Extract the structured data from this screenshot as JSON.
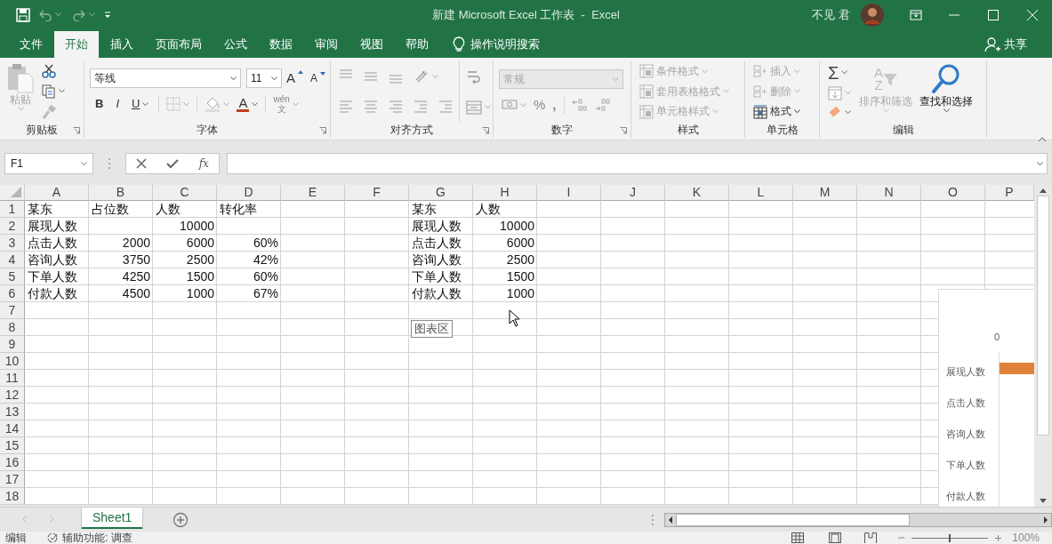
{
  "title_bar": {
    "title": "新建 Microsoft Excel 工作表  -  Excel",
    "user": "不见 君"
  },
  "ribbon_tabs": [
    {
      "label": "文件",
      "selected": false
    },
    {
      "label": "开始",
      "selected": true
    },
    {
      "label": "插入",
      "selected": false
    },
    {
      "label": "页面布局",
      "selected": false
    },
    {
      "label": "公式",
      "selected": false
    },
    {
      "label": "数据",
      "selected": false
    },
    {
      "label": "审阅",
      "selected": false
    },
    {
      "label": "视图",
      "selected": false
    },
    {
      "label": "帮助",
      "selected": false
    }
  ],
  "tell_me": "操作说明搜索",
  "share": "共享",
  "clipboard": {
    "paste": {
      "label": "粘贴",
      "disabled": true
    },
    "label": "剪贴板"
  },
  "font": {
    "name": "等线",
    "size": "11",
    "grow": "A",
    "shrink": "A",
    "styles": [
      "B",
      "I",
      "U"
    ],
    "color_letter": "A",
    "phonetic": [
      "wén",
      "文"
    ],
    "label": "字体"
  },
  "alignment": {
    "label": "对齐方式"
  },
  "number": {
    "format": {
      "value": "常规",
      "disabled": true
    },
    "percent": "%",
    "comma": ",",
    "label": "数字"
  },
  "styles": {
    "items": [
      {
        "label": "条件格式",
        "disabled": true
      },
      {
        "label": "套用表格格式",
        "disabled": true
      },
      {
        "label": "单元格样式",
        "disabled": true
      }
    ],
    "label": "样式"
  },
  "cells": {
    "items": [
      {
        "label": "插入",
        "disabled": true
      },
      {
        "label": "删除",
        "disabled": true
      },
      {
        "label": "格式",
        "disabled": false
      }
    ],
    "label": "单元格"
  },
  "editing": {
    "sum": "Σ",
    "sort": {
      "letters": [
        "A",
        "Z"
      ],
      "label": "排序和筛选",
      "disabled": true
    },
    "find": {
      "label": "查找和选择",
      "disabled": false
    },
    "label": "编辑"
  },
  "formula_bar": {
    "name_box": "F1",
    "fx": "fx"
  },
  "grid": {
    "columns": [
      "A",
      "B",
      "C",
      "D",
      "E",
      "F",
      "G",
      "H",
      "I",
      "J",
      "K",
      "L",
      "M",
      "N",
      "O",
      "P"
    ],
    "rows": [
      {
        "header": "1",
        "cells": [
          {
            "kind": "text",
            "text": "某东"
          },
          {
            "kind": "text",
            "text": "占位数"
          },
          {
            "kind": "text",
            "text": "人数"
          },
          {
            "kind": "text",
            "text": "转化率"
          },
          {
            "kind": "empty"
          },
          {
            "kind": "empty"
          },
          {
            "kind": "text",
            "text": "某东"
          },
          {
            "kind": "text",
            "text": "人数"
          }
        ]
      },
      {
        "header": "2",
        "cells": [
          {
            "kind": "text",
            "text": "展现人数"
          },
          {
            "kind": "empty"
          },
          {
            "kind": "number",
            "text": "10000"
          },
          {
            "kind": "empty"
          },
          {
            "kind": "empty"
          },
          {
            "kind": "empty"
          },
          {
            "kind": "text",
            "text": "展现人数"
          },
          {
            "kind": "number",
            "text": "10000"
          }
        ]
      },
      {
        "header": "3",
        "cells": [
          {
            "kind": "text",
            "text": "点击人数"
          },
          {
            "kind": "number",
            "text": "2000"
          },
          {
            "kind": "number",
            "text": "6000"
          },
          {
            "kind": "number",
            "text": "60%"
          },
          {
            "kind": "empty"
          },
          {
            "kind": "empty"
          },
          {
            "kind": "text",
            "text": "点击人数"
          },
          {
            "kind": "number",
            "text": "6000"
          }
        ]
      },
      {
        "header": "4",
        "cells": [
          {
            "kind": "text",
            "text": "咨询人数"
          },
          {
            "kind": "number",
            "text": "3750"
          },
          {
            "kind": "number",
            "text": "2500"
          },
          {
            "kind": "number",
            "text": "42%"
          },
          {
            "kind": "empty"
          },
          {
            "kind": "empty"
          },
          {
            "kind": "text",
            "text": "咨询人数"
          },
          {
            "kind": "number",
            "text": "2500"
          }
        ]
      },
      {
        "header": "5",
        "cells": [
          {
            "kind": "text",
            "text": "下单人数"
          },
          {
            "kind": "number",
            "text": "4250"
          },
          {
            "kind": "number",
            "text": "1500"
          },
          {
            "kind": "number",
            "text": "60%"
          },
          {
            "kind": "empty"
          },
          {
            "kind": "empty"
          },
          {
            "kind": "text",
            "text": "下单人数"
          },
          {
            "kind": "number",
            "text": "1500"
          }
        ]
      },
      {
        "header": "6",
        "cells": [
          {
            "kind": "text",
            "text": "付款人数"
          },
          {
            "kind": "number",
            "text": "4500"
          },
          {
            "kind": "number",
            "text": "1000"
          },
          {
            "kind": "number",
            "text": "67%"
          },
          {
            "kind": "empty"
          },
          {
            "kind": "empty"
          },
          {
            "kind": "text",
            "text": "付款人数"
          },
          {
            "kind": "number",
            "text": "1000"
          }
        ]
      },
      {
        "header": "7"
      },
      {
        "header": "8"
      },
      {
        "header": "9"
      },
      {
        "header": "10"
      },
      {
        "header": "11"
      },
      {
        "header": "12"
      },
      {
        "header": "13"
      },
      {
        "header": "14"
      },
      {
        "header": "15"
      },
      {
        "header": "16"
      },
      {
        "header": "17"
      },
      {
        "header": "18"
      }
    ]
  },
  "tooltip": "图表区",
  "chart": {
    "axis_label": "0",
    "categories": [
      {
        "label": "展现人数",
        "bar": true
      },
      {
        "label": "点击人数",
        "bar": false
      },
      {
        "label": "咨询人数",
        "bar": false
      },
      {
        "label": "下单人数",
        "bar": false
      },
      {
        "label": "付款人数",
        "bar": false
      }
    ]
  },
  "sheet_tabs": [
    {
      "label": "Sheet1",
      "selected": true
    }
  ],
  "status_bar": {
    "mode": "编辑",
    "accessibility": "辅助功能: 调查",
    "zoom_slider": {
      "level": 0.5
    },
    "zoom": "100%"
  }
}
